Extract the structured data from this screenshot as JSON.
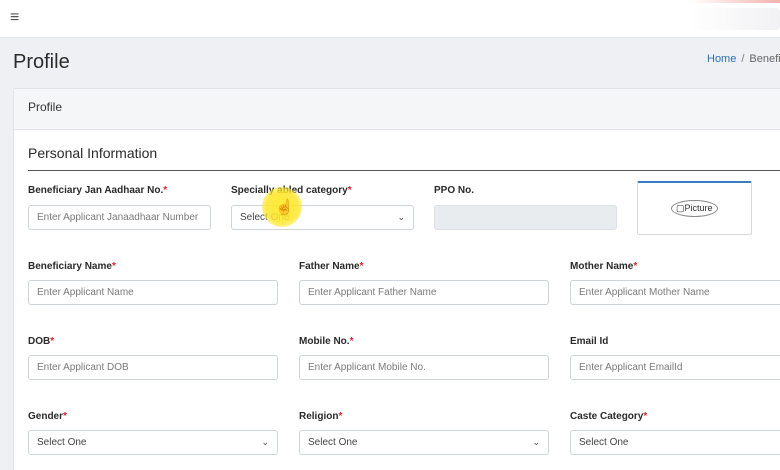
{
  "topbar": {
    "menu_icon": "hamburger-icon",
    "menu_glyph": "≡"
  },
  "page": {
    "title": "Profile",
    "breadcrumb": {
      "home": "Home",
      "separator": "/",
      "current": "Benefi"
    }
  },
  "card": {
    "header": "Profile",
    "section_title": "Personal Information",
    "required_mark": "*",
    "fields": {
      "jan_aadhaar": {
        "label": "Beneficiary Jan Aadhaar No.",
        "placeholder": "Enter Applicant Janaadhaar Number"
      },
      "specially_abled": {
        "label": "Specially abled category",
        "value": "Select One"
      },
      "ppo": {
        "label": "PPO No.",
        "value": ""
      },
      "picture": {
        "alt_text": "Picture"
      },
      "beneficiary_name": {
        "label": "Beneficiary Name",
        "placeholder": "Enter Applicant Name"
      },
      "father_name": {
        "label": "Father Name",
        "placeholder": "Enter Applicant Father Name"
      },
      "mother_name": {
        "label": "Mother Name",
        "placeholder": "Enter Applicant Mother Name"
      },
      "dob": {
        "label": "DOB",
        "placeholder": "Enter Applicant DOB"
      },
      "mobile": {
        "label": "Mobile No.",
        "placeholder": "Enter Applicant Mobile No."
      },
      "email": {
        "label": "Email Id",
        "placeholder": "Enter Applicant EmailId"
      },
      "gender": {
        "label": "Gender",
        "value": "Select One"
      },
      "religion": {
        "label": "Religion",
        "value": "Select One"
      },
      "caste": {
        "label": "Caste Category",
        "value": "Select One"
      }
    }
  },
  "colors": {
    "accent": "#2f6fb5",
    "required": "#d9232e",
    "highlight": "#ffe828"
  }
}
